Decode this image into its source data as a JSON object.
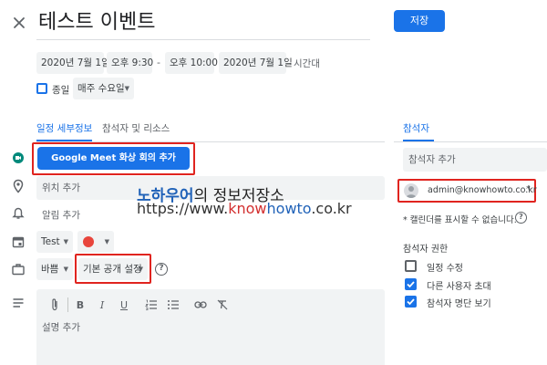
{
  "header": {
    "title": "테스트 이벤트",
    "save_label": "저장"
  },
  "datetime": {
    "start_date": "2020년 7월 1일",
    "start_time": "오후 9:30",
    "separator": "-",
    "end_time": "오후 10:00",
    "end_date": "2020년 7월 1일",
    "timezone_label": "시간대"
  },
  "allday": {
    "label": "종일",
    "checked": false,
    "repeat_value": "매주 수요일"
  },
  "tabs": [
    {
      "label": "일정 세부정보",
      "active": true
    },
    {
      "label": "참석자 및 리소스",
      "active": false
    }
  ],
  "meet": {
    "button_label": "Google Meet 화상 회의 추가"
  },
  "location": {
    "placeholder": "위치 추가"
  },
  "notification": {
    "label": "알림 추가"
  },
  "calendar": {
    "name": "Test",
    "color": "#e8453c"
  },
  "status": {
    "busy_value": "바쁨",
    "visibility_value": "기본 공개 설정"
  },
  "description": {
    "placeholder": "설명 추가"
  },
  "watermark": {
    "line1_colored": "노하우어",
    "line1_rest": "의 정보저장소",
    "url_prefix": "https://www.",
    "url_know": "know",
    "url_howto": "howto",
    "url_suffix": ".co.kr"
  },
  "guests": {
    "title": "참석자",
    "add_placeholder": "참석자 추가",
    "guest_email": "admin@knowhowto.co.kr",
    "guest_marker": "*",
    "calendar_notice": "* 캘린더를 표시할 수 없습니다.",
    "permissions_title": "참석자 권한",
    "permissions": [
      {
        "label": "일정 수정",
        "checked": false
      },
      {
        "label": "다른 사용자 초대",
        "checked": true
      },
      {
        "label": "참석자 명단 보기",
        "checked": true
      }
    ]
  },
  "colors": {
    "accent": "#1a73e8",
    "highlight_box": "#e0241f",
    "watermark_blue": "#2062b8",
    "watermark_red": "#d32f2f"
  }
}
